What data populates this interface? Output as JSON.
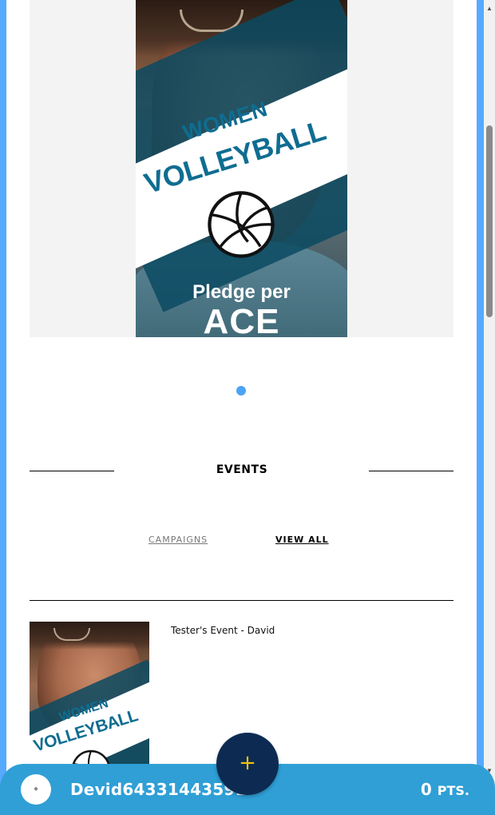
{
  "banner": {
    "poster": {
      "line1": "WOMEN",
      "line2": "VOLLEYBALL",
      "line3": "Pledge per",
      "line4": "ACE",
      "ball_icon": "volleyball-icon"
    },
    "carousel_dot_color": "#4da3f5"
  },
  "events_section": {
    "title": "EVENTS",
    "links": {
      "campaigns": "CAMPAIGNS",
      "view_all": "VIEW ALL"
    }
  },
  "events": [
    {
      "name": "Tester's Event - David",
      "thumb_line1": "WOMEN",
      "thumb_line2": "VOLLEYBALL"
    }
  ],
  "footer": {
    "username": "Devid64331443591",
    "points": "0",
    "points_unit": "PTS.",
    "fab_icon": "plus-icon",
    "avatar_icon": "user-icon",
    "bar_color": "#2f9fd6",
    "fab_color": "#0d2b52",
    "fab_icon_color": "#f1c40f"
  },
  "colors": {
    "frame": "#55aaff",
    "poster_text": "#0f6d91"
  }
}
